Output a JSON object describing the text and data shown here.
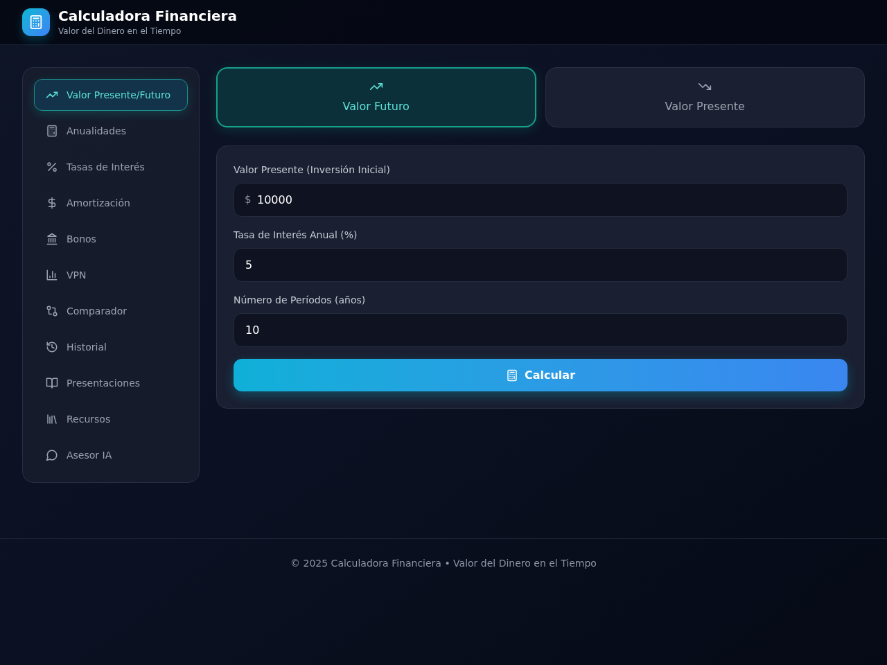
{
  "header": {
    "title": "Calculadora Financiera",
    "subtitle": "Valor del Dinero en el Tiempo"
  },
  "sidebar": {
    "items": [
      {
        "label": "Valor Presente/Futuro",
        "selected": true
      },
      {
        "label": "Anualidades",
        "selected": false
      },
      {
        "label": "Tasas de Interés",
        "selected": false
      },
      {
        "label": "Amortización",
        "selected": false
      },
      {
        "label": "Bonos",
        "selected": false
      },
      {
        "label": "VPN",
        "selected": false
      },
      {
        "label": "Comparador",
        "selected": false
      },
      {
        "label": "Historial",
        "selected": false
      },
      {
        "label": "Presentaciones",
        "selected": false
      },
      {
        "label": "Recursos",
        "selected": false
      },
      {
        "label": "Asesor IA",
        "selected": false
      }
    ]
  },
  "tabs": [
    {
      "label": "Valor Futuro",
      "selected": true
    },
    {
      "label": "Valor Presente",
      "selected": false
    }
  ],
  "form": {
    "fields": [
      {
        "label": "Valor Presente (Inversión Inicial)",
        "prefix": "$",
        "value": "10000"
      },
      {
        "label": "Tasa de Interés Anual (%)",
        "value": "5"
      },
      {
        "label": "Número de Períodos (años)",
        "value": "10"
      }
    ],
    "button": "Calcular"
  },
  "footer": "© 2025 Calculadora Financiera • Valor del Dinero en el Tiempo"
}
